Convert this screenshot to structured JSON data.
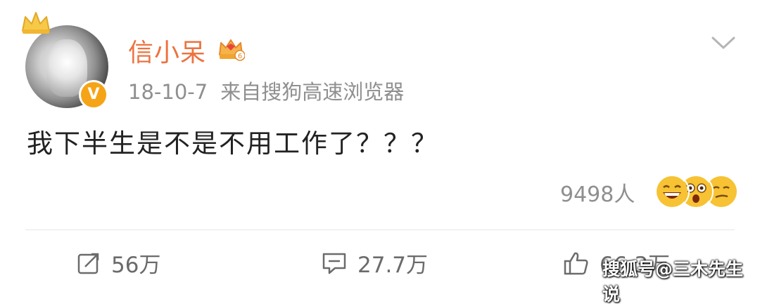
{
  "post": {
    "username": "信小呆",
    "vip_level": "6",
    "verified_badge": "V",
    "date": "18-10-7",
    "source": "来自搜狗高速浏览器",
    "content": "我下半生是不是不用工作了？？？",
    "reaction_count": "9498人",
    "reaction_emojis": [
      "grinning-face",
      "astonished-face",
      "smirking-face"
    ]
  },
  "actions": {
    "share_count": "56万",
    "comment_count": "27.7万",
    "like_count": "66.3万"
  },
  "watermark": {
    "text": "搜狐号@三木先生说"
  },
  "colors": {
    "username": "#eb7340",
    "meta_text": "#8f8f8f",
    "badge": "#f5a417",
    "content": "#222222"
  }
}
